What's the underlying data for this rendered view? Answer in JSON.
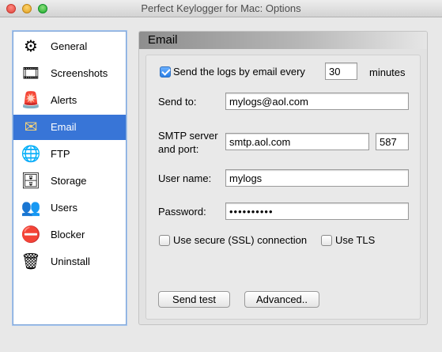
{
  "window": {
    "title": "Perfect Keylogger for Mac: Options"
  },
  "sidebar": {
    "items": [
      {
        "label": "General",
        "icon": "general-icon",
        "glyph": "⚙"
      },
      {
        "label": "Screenshots",
        "icon": "film-reel-icon",
        "glyph": "🎞"
      },
      {
        "label": "Alerts",
        "icon": "siren-icon",
        "glyph": "🚨"
      },
      {
        "label": "Email",
        "icon": "envelope-icon",
        "glyph": "✉"
      },
      {
        "label": "FTP",
        "icon": "globe-icon",
        "glyph": "🌐"
      },
      {
        "label": "Storage",
        "icon": "hard-drive-icon",
        "glyph": "🗄"
      },
      {
        "label": "Users",
        "icon": "users-icon",
        "glyph": "👥"
      },
      {
        "label": "Blocker",
        "icon": "block-icon",
        "glyph": "⛔"
      },
      {
        "label": "Uninstall",
        "icon": "trash-icon",
        "glyph": "🗑"
      }
    ],
    "selected": "Email"
  },
  "panel": {
    "title": "Email",
    "send_logs": {
      "label": "Send the logs by email every",
      "checked": true,
      "interval": "30",
      "unit": "minutes"
    },
    "send_to": {
      "label": "Send to:",
      "value": "mylogs@aol.com"
    },
    "smtp": {
      "label_line1": "SMTP server",
      "label_line2": "and port:",
      "server": "smtp.aol.com",
      "port": "587"
    },
    "user_name": {
      "label": "User name:",
      "value": "mylogs"
    },
    "password": {
      "label": "Password:",
      "value": "••••••••••"
    },
    "ssl": {
      "label": "Use secure (SSL) connection",
      "checked": false
    },
    "tls": {
      "label": "Use TLS",
      "checked": false
    },
    "buttons": {
      "send_test": "Send test",
      "advanced": "Advanced.."
    }
  },
  "colors": {
    "selection": "#3875d7",
    "checkbox_accent": "#2a7fe6"
  }
}
